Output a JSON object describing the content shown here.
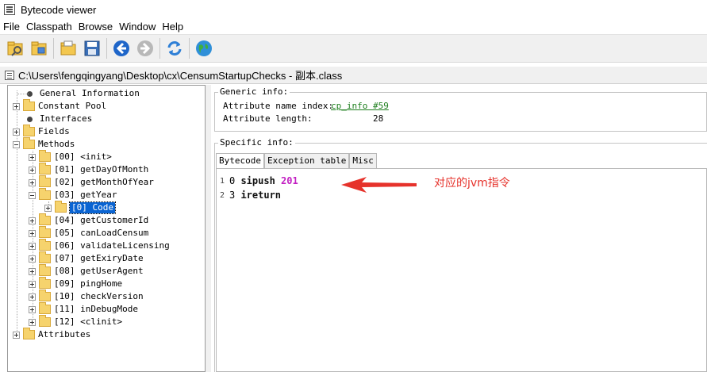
{
  "window": {
    "title": "Bytecode viewer"
  },
  "menu": [
    "File",
    "Classpath",
    "Browse",
    "Window",
    "Help"
  ],
  "toolbar": {
    "buttons": [
      "open-class-icon",
      "open-jar-icon",
      "open-folder-icon",
      "save-icon",
      "back-icon",
      "forward-icon",
      "refresh-icon",
      "web-icon"
    ]
  },
  "path": {
    "text": "C:\\Users\\fengqingyang\\Desktop\\cx\\CensumStartupChecks - 副本.class"
  },
  "tree": {
    "general_information": "General Information",
    "constant_pool": "Constant Pool",
    "interfaces": "Interfaces",
    "fields": "Fields",
    "methods": "Methods",
    "method_items": [
      "[00] <init>",
      "[01] getDayOfMonth",
      "[02] getMonthOfYear",
      "[03] getYear",
      "[04] getCustomerId",
      "[05] canLoadCensum",
      "[06] validateLicensing",
      "[07] getExiryDate",
      "[08] getUserAgent",
      "[09] pingHome",
      "[10] checkVersion",
      "[11] inDebugMode",
      "[12] <clinit>"
    ],
    "selected_child": "[0] Code",
    "attributes": "Attributes"
  },
  "generic_info": {
    "title": "Generic info:",
    "name_index_label": "Attribute name index:",
    "name_index_value": "cp_info #59",
    "length_label": "Attribute length:",
    "length_value": "28"
  },
  "specific_info": {
    "title": "Specific info:",
    "tabs": [
      "Bytecode",
      "Exception table",
      "Misc"
    ]
  },
  "bytecode": {
    "lines": [
      {
        "line": "1",
        "offset": "0",
        "op": "sipush",
        "arg": "201"
      },
      {
        "line": "2",
        "offset": "3",
        "op": "ireturn",
        "arg": ""
      }
    ]
  },
  "annotation": {
    "text": "对应的jvm指令",
    "color": "#e6322b"
  }
}
